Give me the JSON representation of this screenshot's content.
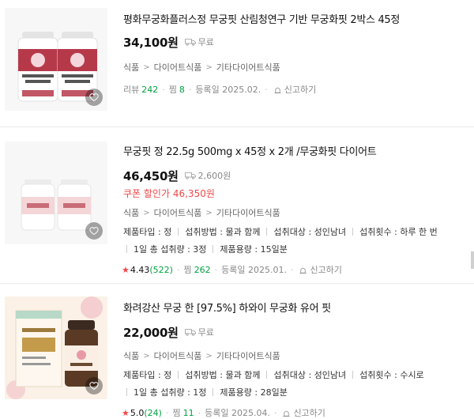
{
  "products": [
    {
      "title": "평화무궁화플러스정 무궁핏 산림청연구 기반 무궁화핏 2박스 45정",
      "price": "34,100원",
      "shipping": "무료",
      "coupon": null,
      "categories": [
        "식품",
        "다이어트식품",
        "기타다이어트식품"
      ],
      "specs": [],
      "meta": {
        "review_label": "리뷰",
        "review_count": "242",
        "zzim_label": "찜",
        "zzim_count": "8",
        "registered": "등록일 2025.02.",
        "report": "신고하기"
      },
      "package_text": "평화무궁화\n플러스 정"
    },
    {
      "title": "무궁핏 정 22.5g 500mg x 45정 x 2개 /무궁화핏 다이어트",
      "price": "46,450원",
      "shipping": "2,600원",
      "coupon": {
        "label": "쿠폰 할인가",
        "price": "46,350원"
      },
      "categories": [
        "식품",
        "다이어트식품",
        "기타다이어트식품"
      ],
      "specs": [
        [
          "제품타입 : 정",
          "섭취방법 : 물과 함께",
          "섭취대상 : 성인남녀",
          "섭취횟수 : 하루 한 번"
        ],
        [
          "1일 총 섭취량 : 3정",
          "제품용량 : 15일분"
        ]
      ],
      "meta": {
        "rating": "4.43",
        "rating_count": "(522)",
        "zzim_label": "찜",
        "zzim_count": "262",
        "registered": "등록일 2025.01.",
        "report": "신고하기"
      },
      "package_text": "무궁핏"
    },
    {
      "title": "화려강산 무궁 한 [97.5%] 하와이 무궁화 유어 핏",
      "price": "22,000원",
      "shipping": "무료",
      "coupon": null,
      "categories": [
        "식품",
        "다이어트식품",
        "기타다이어트식품"
      ],
      "specs": [
        [
          "제품타입 : 정",
          "섭취방법 : 물과 함께",
          "섭취대상 : 성인남녀",
          "섭취횟수 : 수시로"
        ],
        [
          "1일 총 섭취량 : 1정",
          "제품용량 : 28일분"
        ]
      ],
      "meta": {
        "rating": "5.0",
        "rating_count": "(24)",
        "zzim_label": "찜",
        "zzim_count": "11",
        "registered": "등록일 2025.04.",
        "report": "신고하기"
      },
      "package_text": "무궁한"
    }
  ],
  "colors": {
    "price_red": "#f04848",
    "green": "#00a341",
    "divider": "#e9e9e9"
  }
}
